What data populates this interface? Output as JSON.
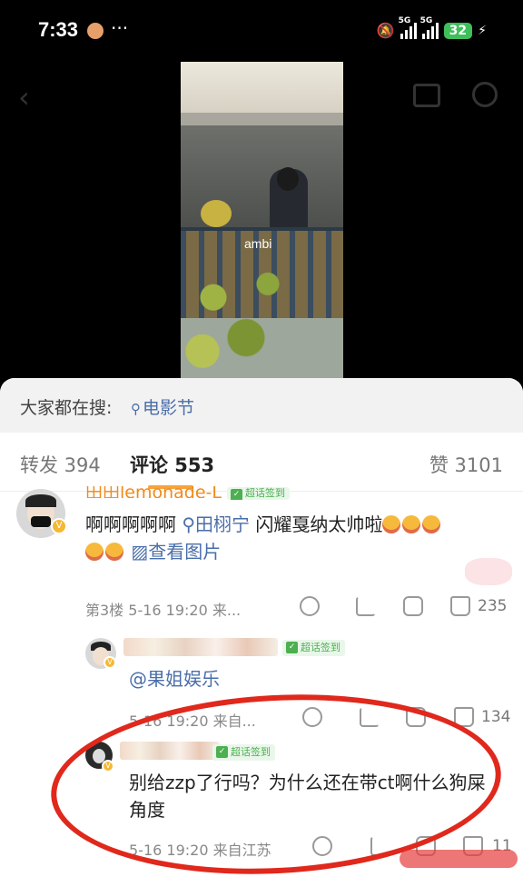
{
  "status_bar": {
    "time": "7:33",
    "dots": "···",
    "signal_1": "5G",
    "signal_2": "5G",
    "battery": "32"
  },
  "video": {
    "watermark": "ambi"
  },
  "hot_search": {
    "label": "大家都在搜:",
    "term": "电影节"
  },
  "tabs": {
    "repost": "转发 394",
    "comments": "评论 553",
    "likes": "赞 3101"
  },
  "comment_1": {
    "username": "田田lemonade-L",
    "badge": "超话签到",
    "text_prefix": "啊啊啊啊啊",
    "mention": "田栩宁",
    "text_suffix": " 闪耀戛纳太帅啦",
    "image_link": "查看图片",
    "meta": "第3楼  5-16 19:20  来...",
    "likes": "235"
  },
  "reply_1": {
    "badge": "超话签到",
    "text": "@果姐娱乐",
    "meta": "5-16 19:20  来自...",
    "likes": "134"
  },
  "reply_2": {
    "badge": "超话签到",
    "text": "别给zzp了行吗？为什么还在带ct啊什么狗屎角度",
    "meta": "5-16 19:20  来自江苏",
    "likes": "11"
  },
  "colors": {
    "accent": "#f7a33a",
    "link": "#4a6ea8",
    "annotation_red": "#e0281c",
    "badge_green": "#4caf50"
  }
}
